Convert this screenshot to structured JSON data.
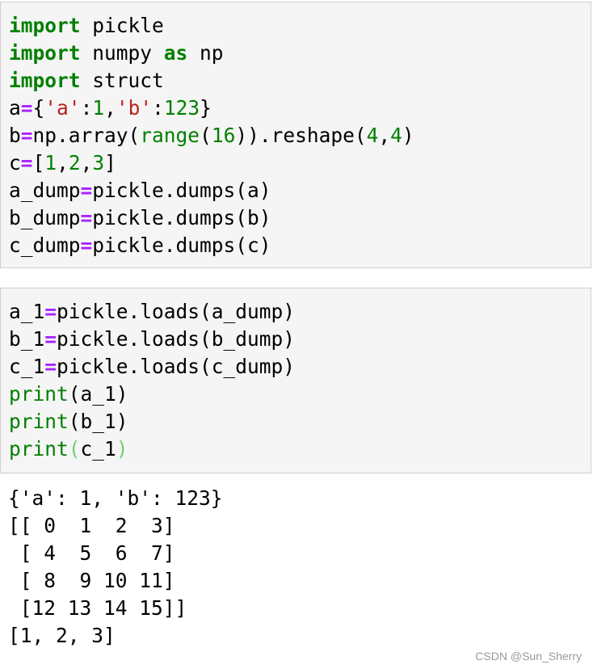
{
  "cell1": {
    "lines": [
      [
        {
          "t": "import",
          "c": "kw"
        },
        {
          "t": " pickle"
        }
      ],
      [
        {
          "t": "import",
          "c": "kw"
        },
        {
          "t": " numpy "
        },
        {
          "t": "as",
          "c": "kw"
        },
        {
          "t": " np"
        }
      ],
      [
        {
          "t": "import",
          "c": "kw"
        },
        {
          "t": " struct"
        }
      ],
      [
        {
          "t": "a"
        },
        {
          "t": "=",
          "c": "op"
        },
        {
          "t": "{"
        },
        {
          "t": "'a'",
          "c": "str"
        },
        {
          "t": ":"
        },
        {
          "t": "1",
          "c": "num"
        },
        {
          "t": ","
        },
        {
          "t": "'b'",
          "c": "str"
        },
        {
          "t": ":"
        },
        {
          "t": "123",
          "c": "num"
        },
        {
          "t": "}"
        }
      ],
      [
        {
          "t": "b"
        },
        {
          "t": "=",
          "c": "op"
        },
        {
          "t": "np.array("
        },
        {
          "t": "range",
          "c": "bi"
        },
        {
          "t": "("
        },
        {
          "t": "16",
          "c": "num"
        },
        {
          "t": ")).reshape("
        },
        {
          "t": "4",
          "c": "num"
        },
        {
          "t": ","
        },
        {
          "t": "4",
          "c": "num"
        },
        {
          "t": ")"
        }
      ],
      [
        {
          "t": "c"
        },
        {
          "t": "=",
          "c": "op"
        },
        {
          "t": "["
        },
        {
          "t": "1",
          "c": "num"
        },
        {
          "t": ","
        },
        {
          "t": "2",
          "c": "num"
        },
        {
          "t": ","
        },
        {
          "t": "3",
          "c": "num"
        },
        {
          "t": "]"
        }
      ],
      [
        {
          "t": "a_dump"
        },
        {
          "t": "=",
          "c": "op"
        },
        {
          "t": "pickle.dumps(a)"
        }
      ],
      [
        {
          "t": "b_dump"
        },
        {
          "t": "=",
          "c": "op"
        },
        {
          "t": "pickle.dumps(b)"
        }
      ],
      [
        {
          "t": "c_dump"
        },
        {
          "t": "=",
          "c": "op"
        },
        {
          "t": "pickle.dumps(c)"
        }
      ]
    ]
  },
  "cell2": {
    "lines": [
      [
        {
          "t": "a_1"
        },
        {
          "t": "=",
          "c": "op"
        },
        {
          "t": "pickle.loads(a_dump)"
        }
      ],
      [
        {
          "t": "b_1"
        },
        {
          "t": "=",
          "c": "op"
        },
        {
          "t": "pickle.loads(b_dump)"
        }
      ],
      [
        {
          "t": "c_1"
        },
        {
          "t": "=",
          "c": "op"
        },
        {
          "t": "pickle.loads(c_dump)"
        }
      ],
      [
        {
          "t": "print",
          "c": "bi"
        },
        {
          "t": "(a_1)"
        }
      ],
      [
        {
          "t": "print",
          "c": "bi"
        },
        {
          "t": "(b_1)"
        }
      ],
      [
        {
          "t": "print",
          "c": "bi"
        },
        {
          "t": "(",
          "c": "hl"
        },
        {
          "t": "c_1"
        },
        {
          "t": ")",
          "c": "hl"
        }
      ]
    ]
  },
  "output": {
    "lines": [
      "{'a': 1, 'b': 123}",
      "[[ 0  1  2  3]",
      " [ 4  5  6  7]",
      " [ 8  9 10 11]",
      " [12 13 14 15]]",
      "[1, 2, 3]"
    ]
  },
  "watermark": "CSDN @Sun_Sherry"
}
